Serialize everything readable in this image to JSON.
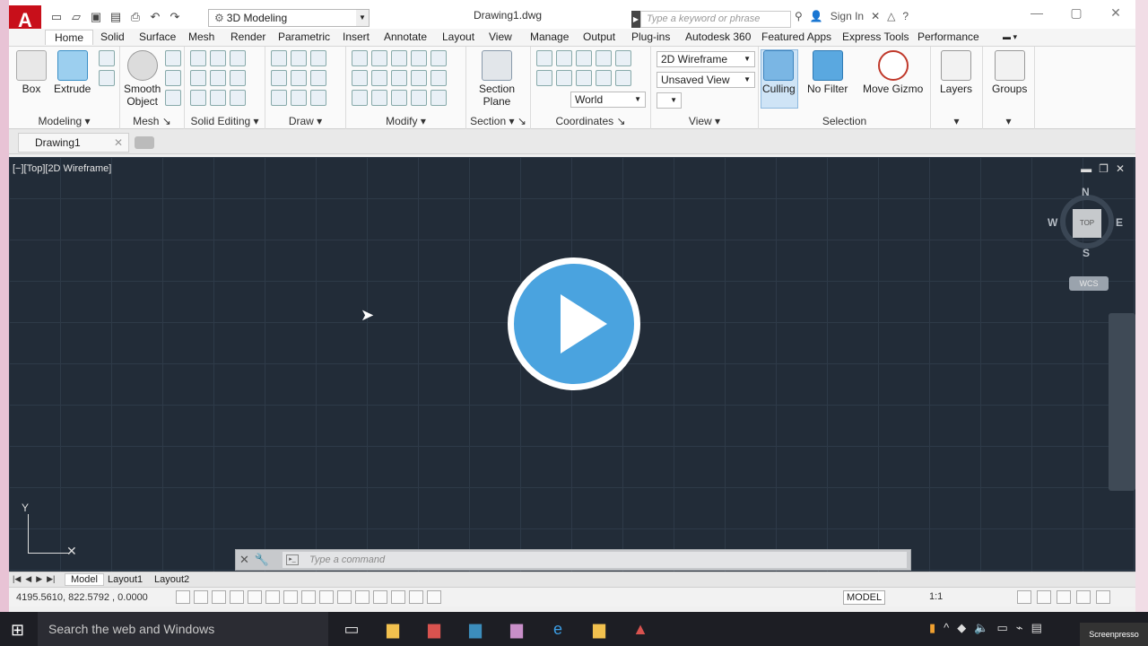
{
  "app": {
    "logo_letter": "A",
    "doc_title": "Drawing1.dwg",
    "workspace": "3D Modeling",
    "search_placeholder": "Type a keyword or phrase",
    "sign_in": "Sign In"
  },
  "ribbon_tabs": [
    "Home",
    "Solid",
    "Surface",
    "Mesh",
    "Render",
    "Parametric",
    "Insert",
    "Annotate",
    "Layout",
    "View",
    "Manage",
    "Output",
    "Plug-ins",
    "Autodesk 360",
    "Featured Apps",
    "Express Tools",
    "Performance"
  ],
  "panels": {
    "modeling": {
      "title": "Modeling",
      "box": "Box",
      "extrude": "Extrude"
    },
    "mesh": {
      "title": "Mesh",
      "smooth_1": "Smooth",
      "smooth_2": "Object"
    },
    "solid_editing": {
      "title": "Solid Editing"
    },
    "draw": {
      "title": "Draw"
    },
    "modify": {
      "title": "Modify"
    },
    "section": {
      "title": "Section",
      "plane_1": "Section",
      "plane_2": "Plane"
    },
    "coordinates": {
      "title": "Coordinates",
      "world": "World"
    },
    "view": {
      "title": "View",
      "visual_style": "2D Wireframe",
      "saved_view": "Unsaved View"
    },
    "selection": {
      "title": "Selection",
      "culling": "Culling",
      "no_filter": "No Filter",
      "move_gizmo": "Move Gizmo"
    },
    "layers": {
      "title": "Layers"
    },
    "groups": {
      "title": "Groups"
    }
  },
  "file_tab": "Drawing1",
  "viewport": {
    "label": "[−][Top][2D Wireframe]",
    "viewcube": {
      "top": "TOP",
      "n": "N",
      "s": "S",
      "e": "E",
      "w": "W",
      "wcs": "WCS"
    },
    "ucs_y": "Y"
  },
  "command": {
    "placeholder": "Type a command"
  },
  "layout_tabs": [
    "Model",
    "Layout1",
    "Layout2"
  ],
  "status": {
    "coords": "4195.5610, 822.5792 , 0.0000",
    "model": "MODEL",
    "scale": "1:1"
  },
  "taskbar": {
    "search": "Search the web and Windows",
    "screenpresso": "Screenpresso"
  }
}
